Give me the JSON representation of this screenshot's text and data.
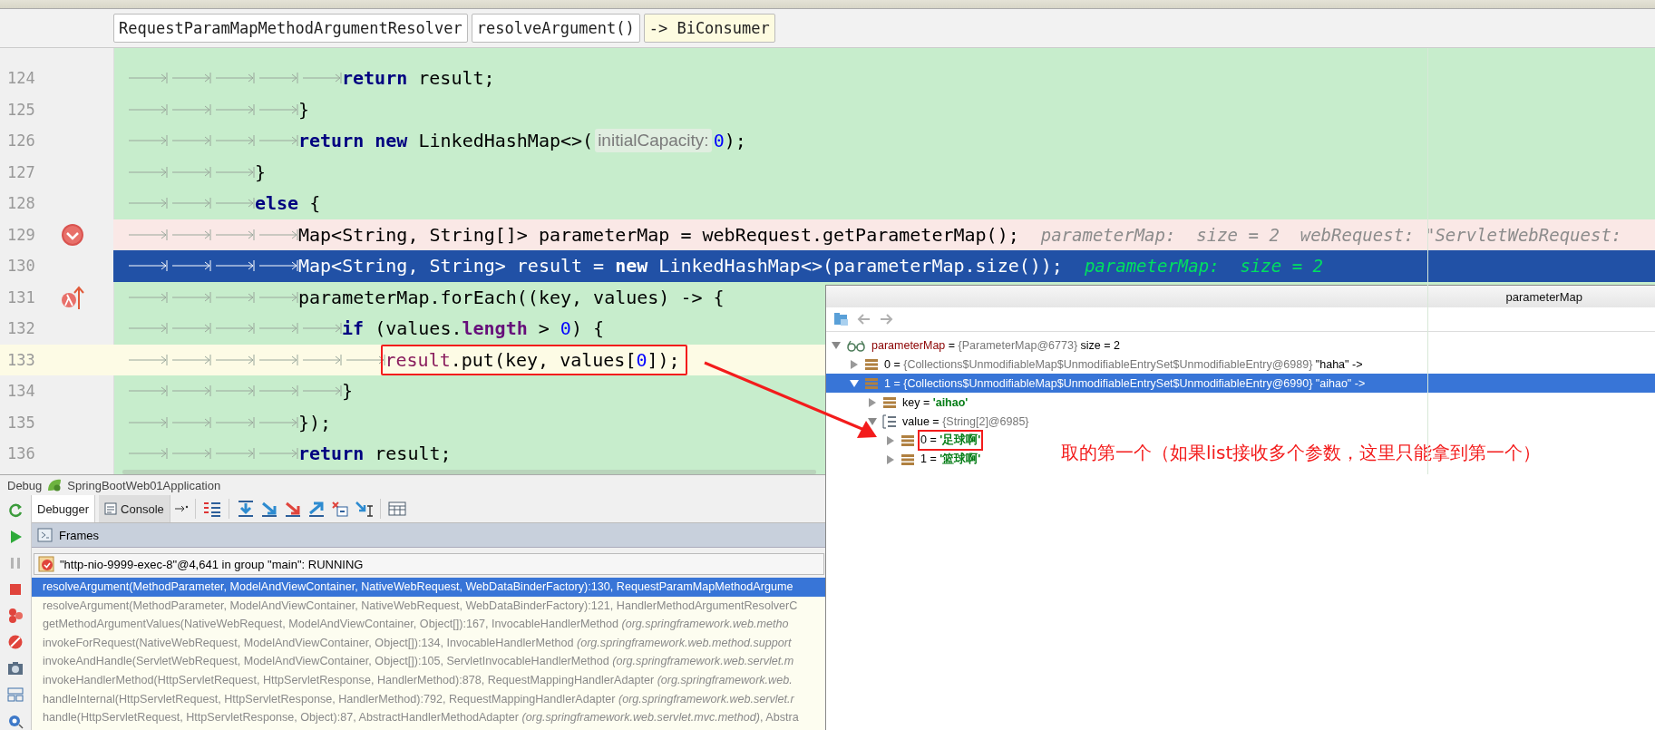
{
  "breadcrumbs": [
    {
      "label": "RequestParamMapMethodArgumentResolver",
      "kind": "class"
    },
    {
      "label": "resolveArgument()",
      "kind": "method"
    },
    {
      "label": "-> BiConsumer",
      "kind": "lambda"
    }
  ],
  "editor": {
    "lines": [
      {
        "number": "124",
        "kind": "normal",
        "indent": [
          {
            "kind": "tab"
          },
          {
            "kind": "tab"
          },
          {
            "kind": "tab"
          },
          {
            "kind": "tab"
          },
          {
            "kind": "tab"
          }
        ],
        "parts": [
          {
            "kind": "code",
            "tokens": [
              {
                "kind": "keyword",
                "text": "return"
              },
              {
                "kind": "plain",
                "text": " result;"
              }
            ]
          }
        ]
      },
      {
        "number": "125",
        "kind": "normal",
        "indent": [
          {
            "kind": "tab"
          },
          {
            "kind": "tab"
          },
          {
            "kind": "tab"
          },
          {
            "kind": "tab"
          }
        ],
        "parts": [
          {
            "kind": "code",
            "tokens": [
              {
                "kind": "plain",
                "text": "}"
              }
            ]
          }
        ]
      },
      {
        "number": "126",
        "kind": "normal",
        "indent": [
          {
            "kind": "tab"
          },
          {
            "kind": "tab"
          },
          {
            "kind": "tab"
          },
          {
            "kind": "tab"
          }
        ],
        "parts": [
          {
            "kind": "code",
            "tokens": [
              {
                "kind": "keyword",
                "text": "return new"
              },
              {
                "kind": "plain",
                "text": " LinkedHashMap<>("
              }
            ]
          },
          {
            "kind": "param-hint",
            "text": "initialCapacity:"
          },
          {
            "kind": "code",
            "tokens": [
              {
                "kind": "number",
                "text": "0"
              },
              {
                "kind": "plain",
                "text": ");"
              }
            ]
          }
        ]
      },
      {
        "number": "127",
        "kind": "normal",
        "indent": [
          {
            "kind": "tab"
          },
          {
            "kind": "tab"
          },
          {
            "kind": "tab"
          }
        ],
        "parts": [
          {
            "kind": "code",
            "tokens": [
              {
                "kind": "plain",
                "text": "}"
              }
            ]
          }
        ]
      },
      {
        "number": "128",
        "kind": "normal",
        "indent": [
          {
            "kind": "tab"
          },
          {
            "kind": "tab"
          },
          {
            "kind": "tab"
          }
        ],
        "parts": [
          {
            "kind": "code",
            "tokens": [
              {
                "kind": "keyword",
                "text": "else"
              },
              {
                "kind": "plain",
                "text": " {"
              }
            ]
          }
        ]
      },
      {
        "number": "129",
        "kind": "breakpoint",
        "indent": [
          {
            "kind": "tab"
          },
          {
            "kind": "tab"
          },
          {
            "kind": "tab"
          },
          {
            "kind": "tab"
          }
        ],
        "parts": [
          {
            "kind": "code",
            "tokens": [
              {
                "kind": "plain",
                "text": "Map<String, String[]> parameterMap = webRequest.getParameterMap();"
              }
            ]
          },
          {
            "kind": "inline-value",
            "text": "parameterMap:  size = 2  webRequest: \"ServletWebRequest:"
          }
        ]
      },
      {
        "number": "130",
        "kind": "current",
        "indent": [
          {
            "kind": "tab"
          },
          {
            "kind": "tab"
          },
          {
            "kind": "tab"
          },
          {
            "kind": "tab"
          }
        ],
        "parts": [
          {
            "kind": "code",
            "tokens": [
              {
                "kind": "plain",
                "text": "Map<String, String> result = "
              },
              {
                "kind": "keyword",
                "text": "new"
              },
              {
                "kind": "plain",
                "text": " LinkedHashMap<>(parameterMap.size());"
              }
            ]
          },
          {
            "kind": "inline-value",
            "text": "parameterMap:  size = 2"
          }
        ]
      },
      {
        "number": "131",
        "kind": "normal",
        "lambda": true,
        "indent": [
          {
            "kind": "tab"
          },
          {
            "kind": "tab"
          },
          {
            "kind": "tab"
          },
          {
            "kind": "tab"
          }
        ],
        "parts": [
          {
            "kind": "code",
            "tokens": [
              {
                "kind": "plain",
                "text": "parameterMap.forEach((key, values) -> {"
              }
            ]
          }
        ]
      },
      {
        "number": "132",
        "kind": "normal",
        "indent": [
          {
            "kind": "tab"
          },
          {
            "kind": "tab"
          },
          {
            "kind": "tab"
          },
          {
            "kind": "tab"
          },
          {
            "kind": "tab"
          }
        ],
        "parts": [
          {
            "kind": "code",
            "tokens": [
              {
                "kind": "keyword",
                "text": "if"
              },
              {
                "kind": "plain",
                "text": " (values."
              },
              {
                "kind": "field",
                "text": "length"
              },
              {
                "kind": "plain",
                "text": " > "
              },
              {
                "kind": "number",
                "text": "0"
              },
              {
                "kind": "plain",
                "text": ") {"
              }
            ]
          }
        ]
      },
      {
        "number": "133",
        "kind": "cursor",
        "indent": [
          {
            "kind": "tab"
          },
          {
            "kind": "tab"
          },
          {
            "kind": "tab"
          },
          {
            "kind": "tab"
          },
          {
            "kind": "tab"
          },
          {
            "kind": "tab"
          }
        ],
        "parts": [
          {
            "kind": "code",
            "boxed": true,
            "tokens": [
              {
                "kind": "captured",
                "text": "result"
              },
              {
                "kind": "plain",
                "text": ".put(key, values["
              },
              {
                "kind": "number",
                "text": "0"
              },
              {
                "kind": "plain",
                "text": "]);"
              }
            ]
          }
        ]
      },
      {
        "number": "134",
        "kind": "normal",
        "indent": [
          {
            "kind": "tab"
          },
          {
            "kind": "tab"
          },
          {
            "kind": "tab"
          },
          {
            "kind": "tab"
          },
          {
            "kind": "tab"
          }
        ],
        "parts": [
          {
            "kind": "code",
            "tokens": [
              {
                "kind": "plain",
                "text": "}"
              }
            ]
          }
        ]
      },
      {
        "number": "135",
        "kind": "normal",
        "indent": [
          {
            "kind": "tab"
          },
          {
            "kind": "tab"
          },
          {
            "kind": "tab"
          },
          {
            "kind": "tab"
          }
        ],
        "parts": [
          {
            "kind": "code",
            "tokens": [
              {
                "kind": "plain",
                "text": "});"
              }
            ]
          }
        ]
      },
      {
        "number": "136",
        "kind": "normal",
        "indent": [
          {
            "kind": "tab"
          },
          {
            "kind": "tab"
          },
          {
            "kind": "tab"
          },
          {
            "kind": "tab"
          }
        ],
        "parts": [
          {
            "kind": "code",
            "tokens": [
              {
                "kind": "keyword",
                "text": "return"
              },
              {
                "kind": "plain",
                "text": " result;"
              }
            ]
          }
        ]
      }
    ]
  },
  "debug": {
    "title": "Debug",
    "config": "SpringBootWeb01Application",
    "tabs": [
      {
        "label": "Debugger",
        "selected": true
      },
      {
        "label": "Console",
        "selected": false
      }
    ],
    "frames_title": "Frames",
    "thread": "\"http-nio-9999-exec-8\"@4,641 in group \"main\": RUNNING",
    "frames": [
      {
        "text": "resolveArgument(MethodParameter, ModelAndViewContainer, NativeWebRequest, WebDataBinderFactory):130, RequestParamMapMethodArgume",
        "selected": true
      },
      {
        "text": "resolveArgument(MethodParameter, ModelAndViewContainer, NativeWebRequest, WebDataBinderFactory):121, HandlerMethodArgumentResolverC",
        "selected": false
      },
      {
        "text": "getMethodArgumentValues(NativeWebRequest, ModelAndViewContainer, Object[]):167, InvocableHandlerMethod *(org.springframework.web.metho*",
        "selected": false
      },
      {
        "text": "invokeForRequest(NativeWebRequest, ModelAndViewContainer, Object[]):134, InvocableHandlerMethod *(org.springframework.web.method.support*",
        "selected": false
      },
      {
        "text": "invokeAndHandle(ServletWebRequest, ModelAndViewContainer, Object[]):105, ServletInvocableHandlerMethod *(org.springframework.web.servlet.m*",
        "selected": false
      },
      {
        "text": "invokeHandlerMethod(HttpServletRequest, HttpServletResponse, HandlerMethod):878, RequestMappingHandlerAdapter *(org.springframework.web.*",
        "selected": false
      },
      {
        "text": "handleInternal(HttpServletRequest, HttpServletResponse, HandlerMethod):792, RequestMappingHandlerAdapter *(org.springframework.web.servlet.r*",
        "selected": false
      },
      {
        "text": "handle(HttpServletRequest, HttpServletResponse, Object):87, AbstractHandlerMethodAdapter *(org.springframework.web.servlet.mvc.method)*, Abstra",
        "selected": false
      }
    ]
  },
  "popup": {
    "title": "parameterMap",
    "tree": [
      {
        "kind": "watch",
        "name": "parameterMap",
        "equals": "=",
        "ref": "{ParameterMap@6773}",
        "value": " size = 2",
        "expanded": true,
        "selected": false,
        "children": [
          {
            "kind": "entry",
            "name": "0",
            "equals": "=",
            "ref": "{Collections$UnmodifiableMap$UnmodifiableEntrySet$UnmodifiableEntry@6989}",
            "value": " \"haha\" ->",
            "expanded": false,
            "selected": false
          },
          {
            "kind": "entry",
            "name": "1",
            "equals": "=",
            "ref": "{Collections$UnmodifiableMap$UnmodifiableEntrySet$UnmodifiableEntry@6990}",
            "value": " \"aihao\" ->",
            "expanded": true,
            "selected": true,
            "children": [
              {
                "kind": "entry",
                "name": "key",
                "equals": "=",
                "string": "'aihao'",
                "expanded": false,
                "selected": false
              },
              {
                "kind": "array",
                "name": "value",
                "equals": "=",
                "ref": "{String[2]@6985}",
                "expanded": true,
                "selected": false,
                "children": [
                  {
                    "kind": "entry",
                    "name": "0",
                    "equals": "=",
                    "string": "'足球啊'",
                    "expanded": false,
                    "selected": false,
                    "boxed": true
                  },
                  {
                    "kind": "entry",
                    "name": "1",
                    "equals": "=",
                    "string": "'篮球啊'",
                    "expanded": false,
                    "selected": false
                  }
                ]
              }
            ]
          }
        ]
      }
    ]
  },
  "annotation": {
    "text": "取的第一个（如果list接收多个参数，这里只能拿到第一个）"
  }
}
